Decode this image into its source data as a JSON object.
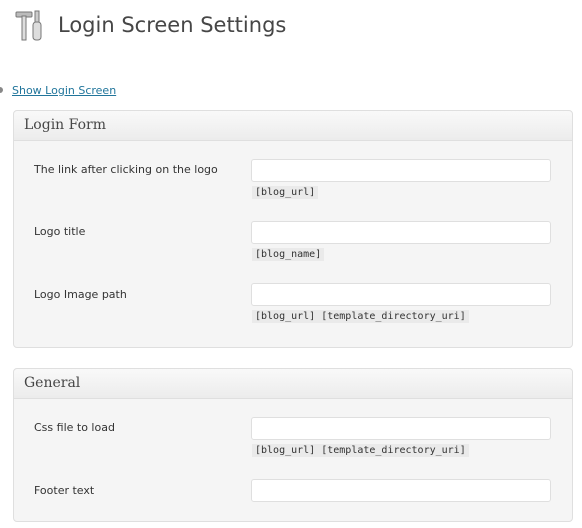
{
  "page": {
    "title": "Login Screen Settings",
    "icon": "tools-icon",
    "show_link": "Show Login Screen"
  },
  "panels": [
    {
      "title": "Login Form",
      "fields": [
        {
          "label": "The link after clicking on the logo",
          "value": "",
          "hint": "[blog_url]"
        },
        {
          "label": "Logo title",
          "value": "",
          "hint": "[blog_name]"
        },
        {
          "label": "Logo Image path",
          "value": "",
          "hint": "[blog_url] [template_directory_uri]"
        }
      ]
    },
    {
      "title": "General",
      "fields": [
        {
          "label": "Css file to load",
          "value": "",
          "hint": "[blog_url] [template_directory_uri]"
        },
        {
          "label": "Footer text",
          "value": ""
        }
      ]
    }
  ]
}
